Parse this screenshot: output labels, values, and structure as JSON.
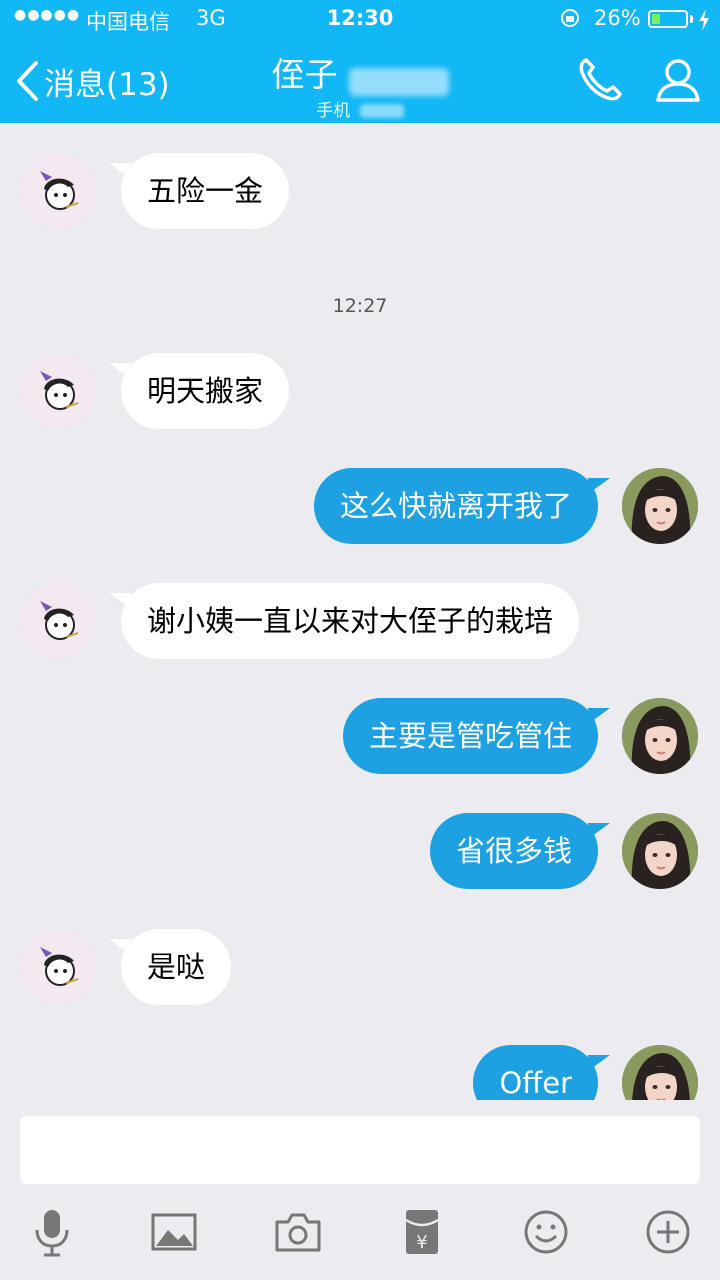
{
  "status_bar": {
    "signal": "●●●●●",
    "carrier": "中国电信",
    "network": "3G",
    "time": "12:30",
    "battery_percent": "26%",
    "battery_level": 0.26
  },
  "header": {
    "back_label": "消息(13)",
    "title": "侄子",
    "subtitle": "手机",
    "icons": [
      "chevron-left-icon",
      "phone-icon",
      "profile-icon"
    ]
  },
  "messages": [
    {
      "side": "in",
      "text": "五险一金"
    },
    {
      "type": "time",
      "text": "12:27"
    },
    {
      "side": "in",
      "text": "明天搬家"
    },
    {
      "side": "out",
      "text": "这么快就离开我了"
    },
    {
      "side": "in",
      "text": "谢小姨一直以来对大侄子的栽培"
    },
    {
      "side": "out",
      "text": "主要是管吃管住"
    },
    {
      "side": "out",
      "text": "省很多钱"
    },
    {
      "side": "in",
      "text": "是哒"
    },
    {
      "side": "out",
      "text": "Offer"
    }
  ],
  "toolbar": {
    "icons": [
      "microphone-icon",
      "image-icon",
      "camera-icon",
      "red-packet-icon",
      "emoji-icon",
      "plus-icon"
    ]
  },
  "colors": {
    "header": "#12b7f5",
    "outgoing_bubble": "#1ea1e3",
    "incoming_bubble": "#ffffff",
    "background": "#ebebf0"
  }
}
